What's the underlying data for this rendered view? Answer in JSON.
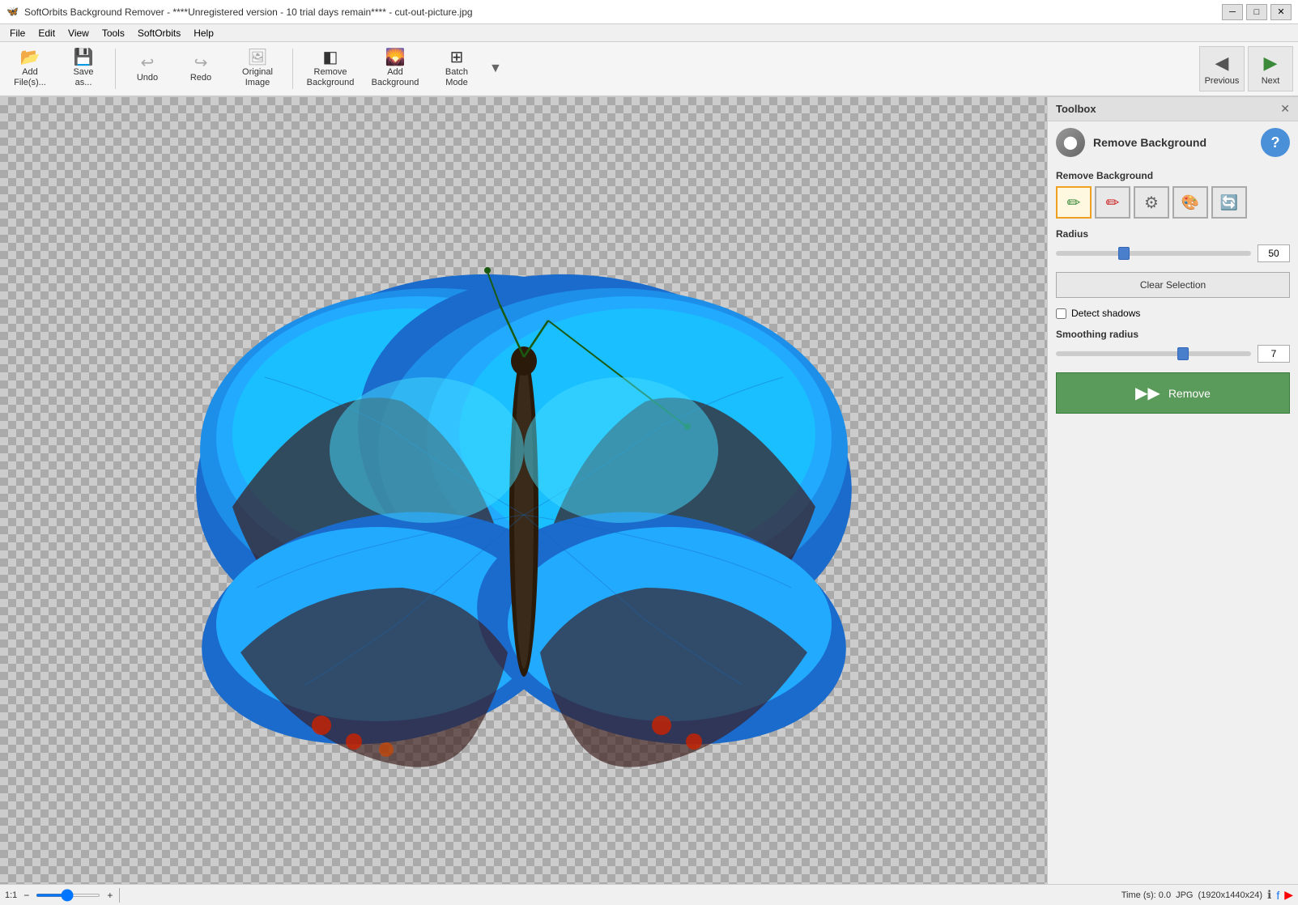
{
  "window": {
    "title": "SoftOrbits Background Remover - ****Unregistered version - 10 trial days remain**** - cut-out-picture.jpg",
    "app_icon": "🖼",
    "min_label": "─",
    "max_label": "□",
    "close_label": "✕"
  },
  "menubar": {
    "items": [
      "File",
      "Edit",
      "View",
      "Tools",
      "SoftOrbits",
      "Help"
    ]
  },
  "toolbar": {
    "buttons": [
      {
        "id": "add-file",
        "icon": "📂",
        "label": "Add\nFile(s)..."
      },
      {
        "id": "save-as",
        "icon": "💾",
        "label": "Save\nas..."
      },
      {
        "id": "undo",
        "icon": "↩",
        "label": "Undo"
      },
      {
        "id": "redo",
        "icon": "↪",
        "label": "Redo"
      },
      {
        "id": "original-image",
        "icon": "🖼",
        "label": "Original\nImage"
      },
      {
        "id": "remove-background",
        "icon": "🔲",
        "label": "Remove\nBackground"
      },
      {
        "id": "add-background",
        "icon": "🌄",
        "label": "Add\nBackground"
      },
      {
        "id": "batch-mode",
        "icon": "⊞",
        "label": "Batch\nMode"
      }
    ],
    "expand_label": "▼",
    "prev_label": "Previous",
    "next_label": "Next"
  },
  "toolbox": {
    "title": "Toolbox",
    "close_label": "✕",
    "section_title": "Remove Background",
    "section_label": "Remove Background",
    "help_label": "?",
    "tool_buttons": [
      {
        "id": "pencil-keep",
        "icon": "✏",
        "color": "green",
        "active": true
      },
      {
        "id": "pencil-remove",
        "icon": "✏",
        "color": "red",
        "active": false
      },
      {
        "id": "magic-wand",
        "icon": "⚙",
        "color": "gray",
        "active": false
      },
      {
        "id": "paint-remove",
        "icon": "🎨",
        "color": "pink",
        "active": false
      },
      {
        "id": "paint-restore",
        "icon": "🔄",
        "color": "blue",
        "active": false
      }
    ],
    "radius_label": "Radius",
    "radius_value": "50",
    "radius_percent": 35,
    "clear_selection_label": "Clear Selection",
    "detect_shadows_label": "Detect shadows",
    "detect_shadows_checked": false,
    "smoothing_radius_label": "Smoothing radius",
    "smoothing_radius_value": "7",
    "smoothing_radius_percent": 65,
    "remove_label": "Remove",
    "remove_icon": "▶▶"
  },
  "statusbar": {
    "zoom_label": "1:1",
    "zoom_icon_min": "−",
    "zoom_icon_max": "+",
    "time_label": "Time (s): 0.0",
    "format_label": "JPG",
    "dimensions_label": "(1920x1440x24)",
    "info_icon": "ℹ",
    "facebook_icon": "f",
    "youtube_icon": "▶"
  }
}
